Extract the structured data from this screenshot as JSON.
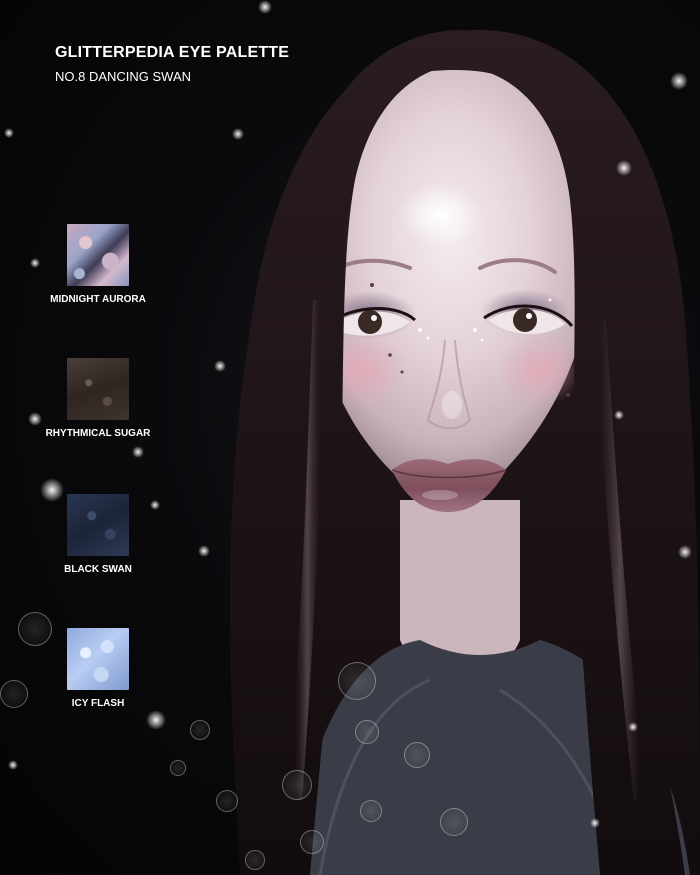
{
  "header": {
    "title": "GLITTERPEDIA EYE PALETTE",
    "subtitle": "NO.8 DANCING SWAN"
  },
  "shades": [
    {
      "label": "MIDNIGHT AURORA",
      "color": "#b7a6c2"
    },
    {
      "label": "RHYTHMICAL SUGAR",
      "color": "#3a302b"
    },
    {
      "label": "BLACK SWAN",
      "color": "#222c42"
    },
    {
      "label": "ICY FLASH",
      "color": "#a9c0ea"
    }
  ],
  "colors": {
    "background": "#050506",
    "text": "#ffffff",
    "hair": "#1c1416",
    "skin": "#eadadd",
    "lips": "#8a5a66"
  }
}
